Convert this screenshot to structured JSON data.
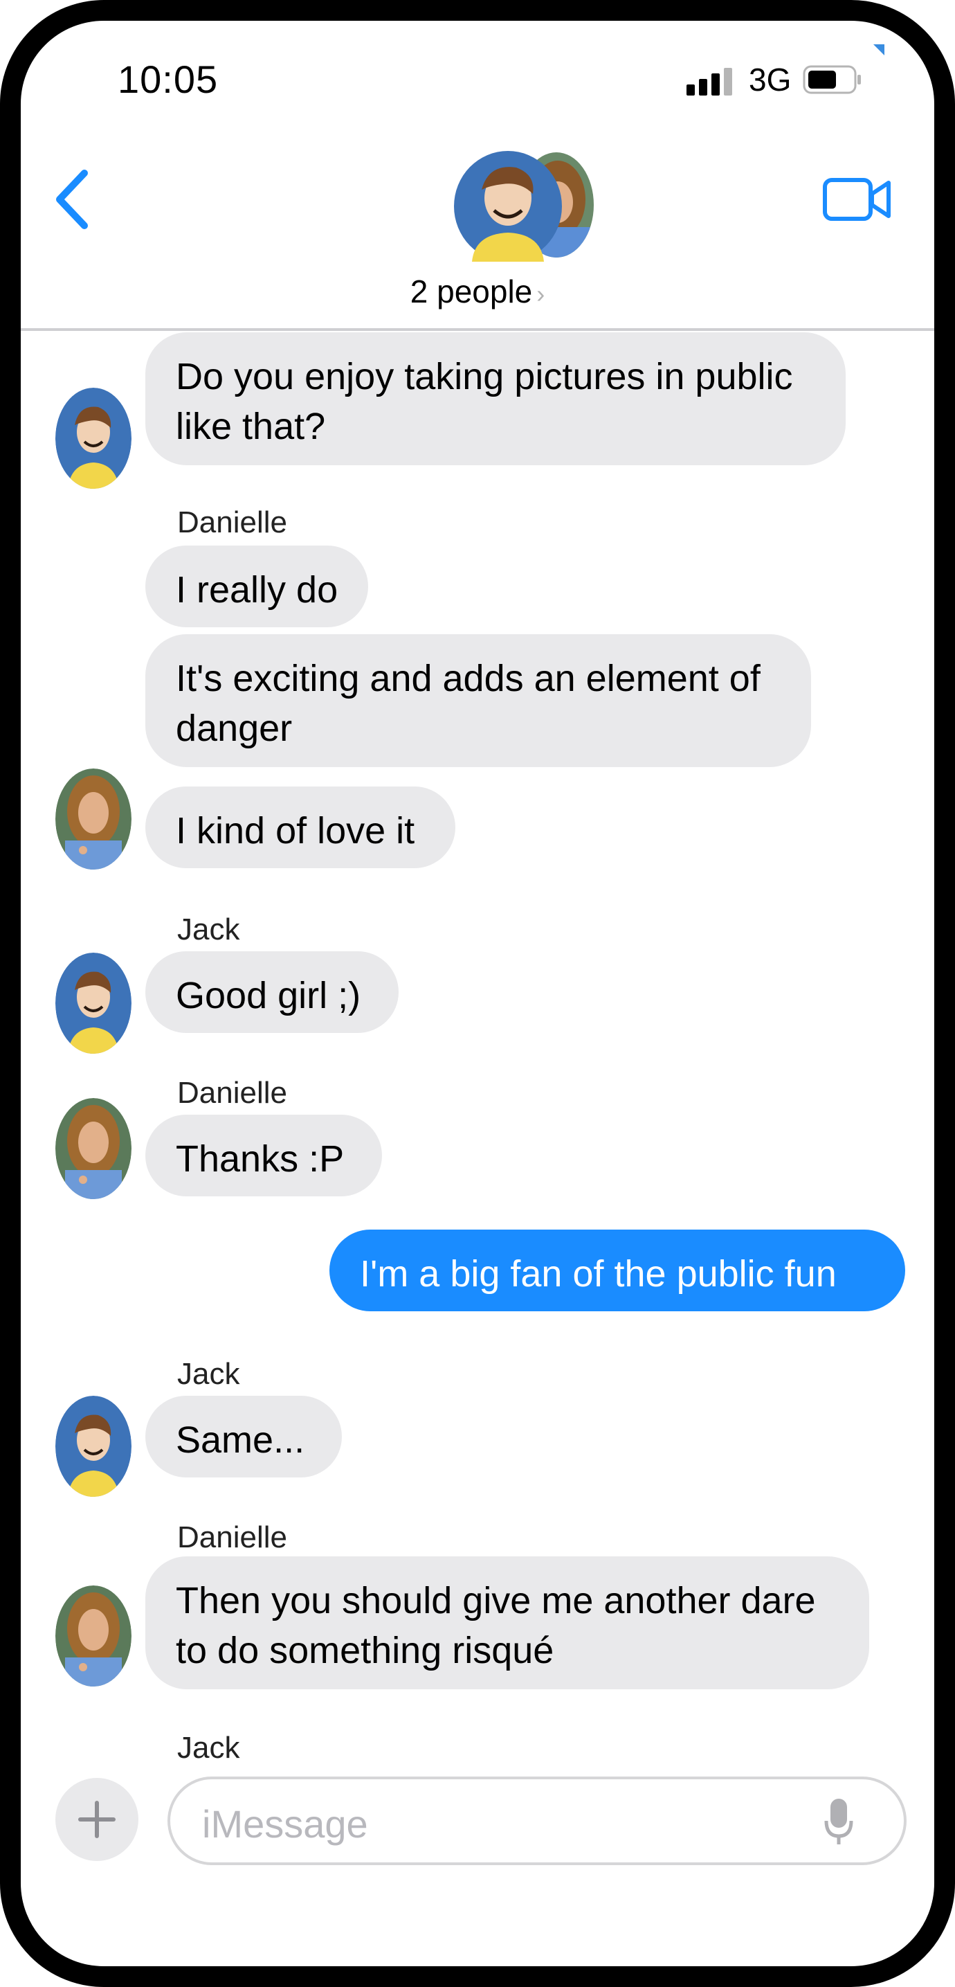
{
  "status_bar": {
    "time": "10:05",
    "network": "3G"
  },
  "header": {
    "group_name": "2 people",
    "chevron": "›"
  },
  "messages": [
    {
      "sender": "",
      "text": "Do you enjoy taking pictures in public\nlike that?"
    },
    {
      "sender": "Danielle",
      "text": "I really do"
    },
    {
      "sender": "",
      "text": "It's exciting and adds an element of\ndanger"
    },
    {
      "sender": "",
      "text": "I kind of love it"
    },
    {
      "sender": "Jack",
      "text": "Good girl ;)"
    },
    {
      "sender": "Danielle",
      "text": "Thanks :P"
    },
    {
      "sender": "",
      "text": "I'm a big fan of the public fun"
    },
    {
      "sender": "Jack",
      "text": "Same..."
    },
    {
      "sender": "Danielle",
      "text": "Then you should give me another dare\nto do something risqué"
    },
    {
      "sender": "Jack",
      "text": ""
    }
  ],
  "composer": {
    "placeholder": "iMessage"
  },
  "colors": {
    "accent": "#1a8cff",
    "incoming_bubble": "#e9e9eb",
    "outgoing_bubble": "#1a8cff"
  },
  "icons": [
    "chevron-left-icon",
    "video-call-icon",
    "plus-icon",
    "microphone-icon",
    "signal-bars-icon",
    "battery-icon"
  ]
}
